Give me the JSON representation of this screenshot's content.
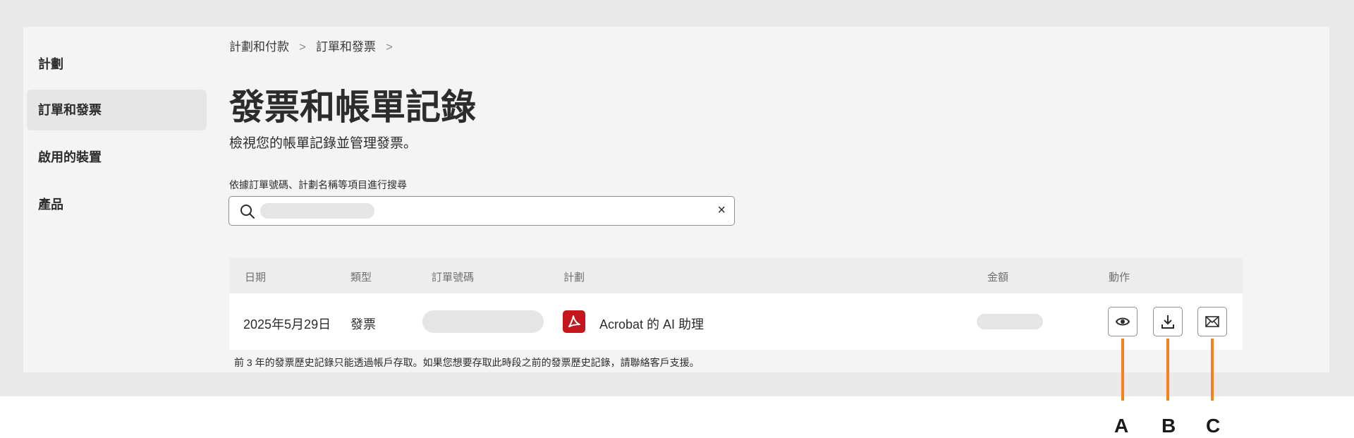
{
  "sidebar": {
    "items": [
      {
        "label": "計劃"
      },
      {
        "label": "訂單和發票"
      },
      {
        "label": "啟用的裝置"
      },
      {
        "label": "產品"
      }
    ]
  },
  "breadcrumb": {
    "items": [
      {
        "label": "計劃和付款"
      },
      {
        "label": "訂單和發票"
      }
    ],
    "separator": ">"
  },
  "page": {
    "title": "發票和帳單記錄",
    "subtitle": "檢視您的帳單記錄並管理發票。"
  },
  "search": {
    "label": "依據訂單號碼、計劃名稱等項目進行搜尋",
    "value": "",
    "clear_symbol": "×"
  },
  "table": {
    "columns": [
      "日期",
      "類型",
      "訂單號碼",
      "計劃",
      "金額",
      "動作"
    ],
    "rows": [
      {
        "date": "2025年5月29日",
        "type": "發票",
        "order_number": "",
        "plan": "Acrobat 的 AI 助理",
        "amount": "",
        "actions": [
          "eye-icon",
          "download-icon",
          "mail-icon"
        ]
      }
    ]
  },
  "footnote": "前 3 年的發票歷史記錄只能透過帳戶存取。如果您想要存取此時段之前的發票歷史記錄，請聯絡客戶支援。",
  "callouts": [
    "A",
    "B",
    "C"
  ],
  "colors": {
    "accent": "#f58220",
    "pdf_red": "#c6161d"
  }
}
